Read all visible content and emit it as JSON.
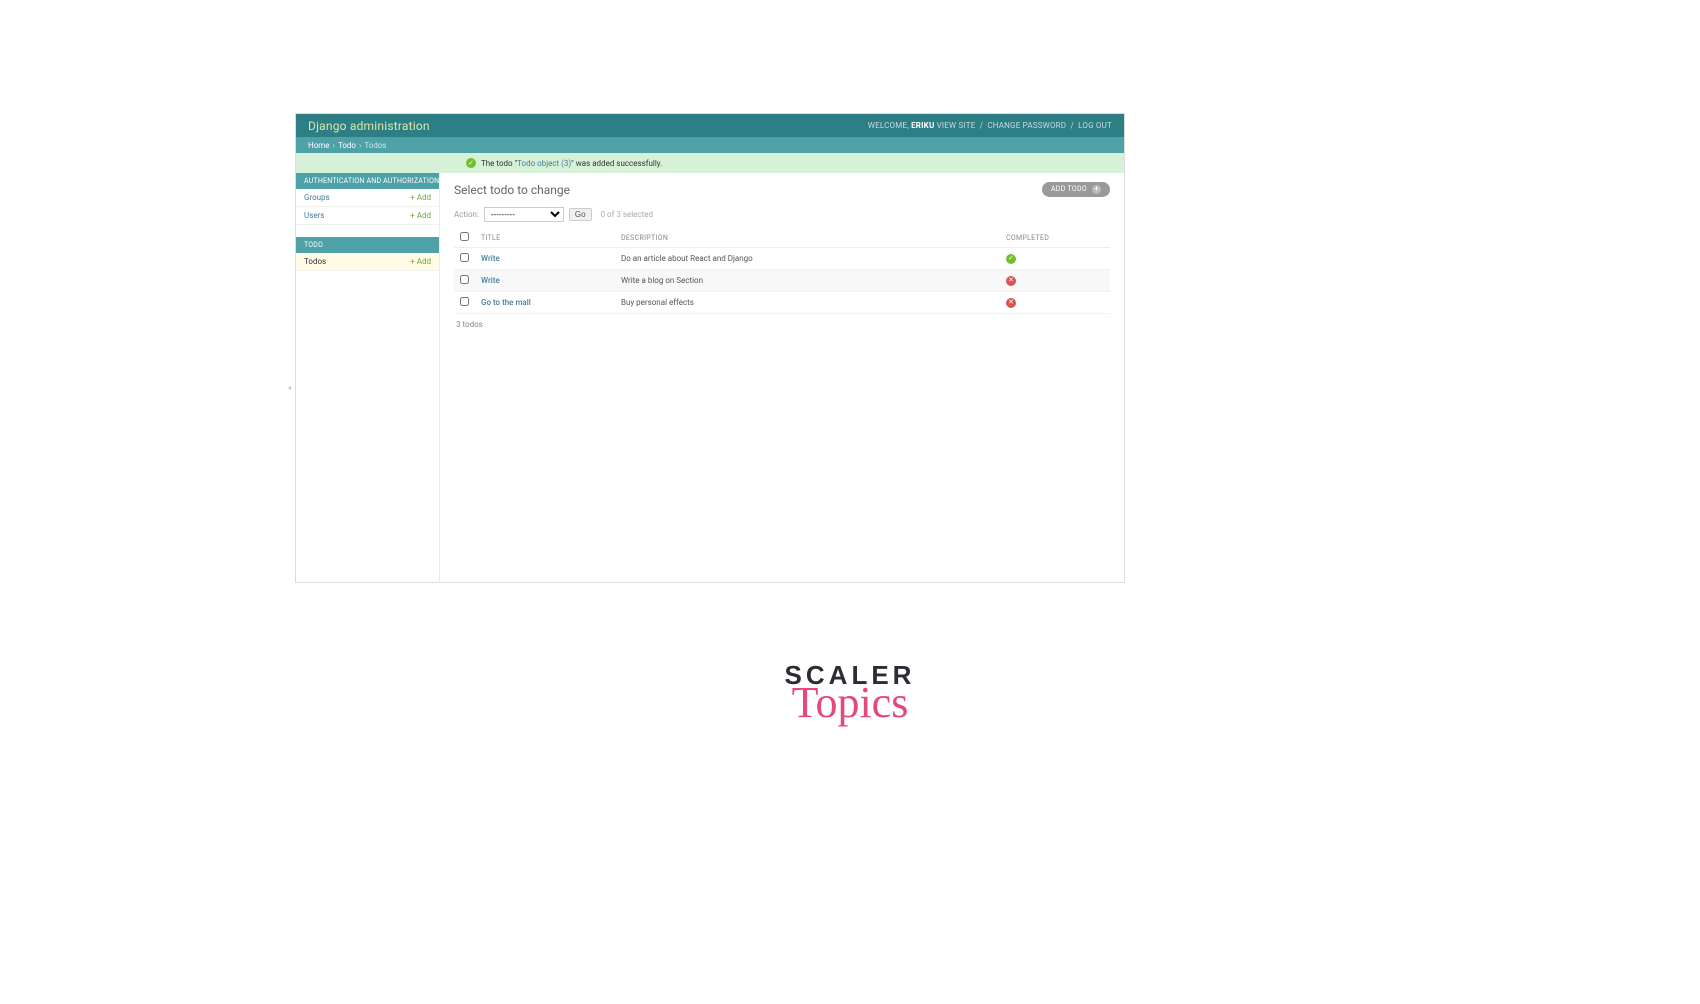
{
  "header": {
    "brand": "Django administration",
    "welcome_label": "WELCOME,",
    "username": "ERIKU",
    "view_site": "VIEW SITE",
    "change_password": "CHANGE PASSWORD",
    "logout": "LOG OUT"
  },
  "breadcrumb": {
    "home": "Home",
    "app": "Todo",
    "current": "Todos"
  },
  "message": {
    "prefix": "The todo \"",
    "link": "Todo object (3)",
    "suffix": "\" was added successfully."
  },
  "sidebar": {
    "groups": [
      {
        "caption": "AUTHENTICATION AND AUTHORIZATION",
        "rows": [
          {
            "model": "Groups",
            "add": "+ Add",
            "current": false
          },
          {
            "model": "Users",
            "add": "+ Add",
            "current": false
          }
        ]
      },
      {
        "caption": "TODO",
        "rows": [
          {
            "model": "Todos",
            "add": "+ Add",
            "current": true
          }
        ]
      }
    ]
  },
  "main": {
    "title": "Select todo to change",
    "add_button": "ADD TODO",
    "actions_label": "Action:",
    "actions_placeholder": "---------",
    "go_label": "Go",
    "selection_counter": "0 of 3 selected"
  },
  "table": {
    "headers": {
      "title": "TITLE",
      "description": "DESCRIPTION",
      "completed": "COMPLETED"
    },
    "rows": [
      {
        "title": "Write",
        "description": "Do an article about React and Django",
        "completed": true
      },
      {
        "title": "Write",
        "description": "Write a blog on Section",
        "completed": false
      },
      {
        "title": "Go to the mall",
        "description": "Buy personal effects",
        "completed": false
      }
    ],
    "paginator": "3 todos"
  },
  "logo": {
    "line1": "SCALER",
    "line2": "Topics"
  }
}
